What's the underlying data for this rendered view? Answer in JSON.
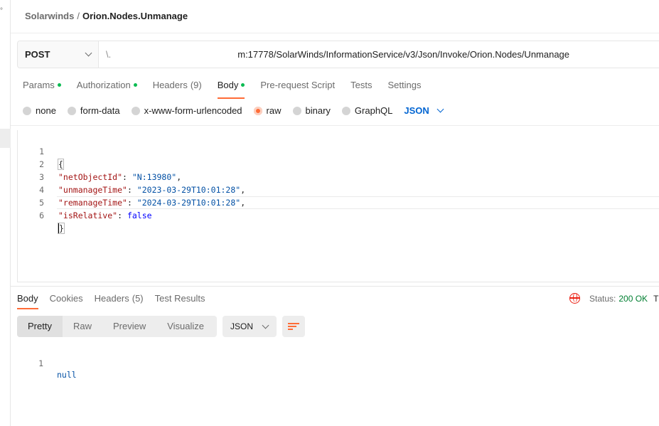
{
  "breadcrumb": {
    "parent": "Solarwinds",
    "separator": "/",
    "current": "Orion.Nodes.Unmanage"
  },
  "request": {
    "method": "POST",
    "url_prefix": "\\.",
    "url_visible": "m:17778/SolarWinds/InformationService/v3/Json/Invoke/Orion.Nodes/Unmanage"
  },
  "tabs": [
    {
      "label": "Params",
      "dot": true
    },
    {
      "label": "Authorization",
      "dot": true
    },
    {
      "label": "Headers",
      "count": "(9)"
    },
    {
      "label": "Body",
      "dot": true,
      "active": true
    },
    {
      "label": "Pre-request Script"
    },
    {
      "label": "Tests"
    },
    {
      "label": "Settings"
    }
  ],
  "body_types": [
    "none",
    "form-data",
    "x-www-form-urlencoded",
    "raw",
    "binary",
    "GraphQL"
  ],
  "body_type_selected": "raw",
  "body_format": "JSON",
  "editor": {
    "line_numbers": [
      "1",
      "2",
      "3",
      "4",
      "5",
      "6"
    ],
    "open_brace": "{",
    "close_brace": "}",
    "fields": [
      {
        "key": "\"netObjectId\"",
        "value": "\"N:13980\"",
        "comma": ","
      },
      {
        "key": "\"unmanageTime\"",
        "value": "\"2023-03-29T10:01:28\"",
        "comma": ","
      },
      {
        "key": "\"remanageTime\"",
        "value": "\"2024-03-29T10:01:28\"",
        "comma": ","
      },
      {
        "key": "\"isRelative\"",
        "value": "false",
        "comma": ""
      }
    ]
  },
  "response": {
    "tabs": [
      {
        "label": "Body",
        "active": true
      },
      {
        "label": "Cookies"
      },
      {
        "label": "Headers",
        "count": "(5)"
      },
      {
        "label": "Test Results"
      }
    ],
    "status_label": "Status:",
    "status_value": "200 OK",
    "status_more": "T",
    "view_modes": [
      "Pretty",
      "Raw",
      "Preview",
      "Visualize"
    ],
    "active_view": "Pretty",
    "format": "JSON",
    "line_number": "1",
    "content": "null"
  },
  "colors": {
    "accent": "#ff6c37",
    "success": "#0cbb52",
    "link": "#0265d2",
    "status_ok": "#007f31",
    "error_icon": "#eb2013"
  },
  "icons": [
    "chevron-down-icon",
    "globe-error-icon",
    "wrap-lines-icon"
  ]
}
